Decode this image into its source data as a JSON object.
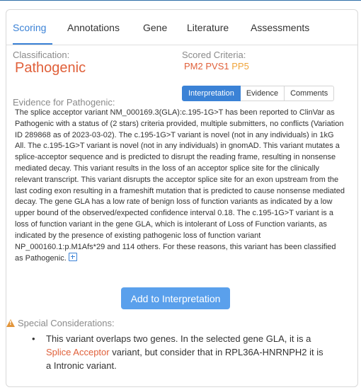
{
  "tabs": [
    {
      "label": "Scoring",
      "active": true
    },
    {
      "label": "Annotations",
      "active": false
    },
    {
      "label": "Gene",
      "active": false
    },
    {
      "label": "Literature",
      "active": false
    },
    {
      "label": "Assessments",
      "active": false
    }
  ],
  "classification": {
    "label": "Classification:",
    "value": "Pathogenic"
  },
  "scored_criteria": {
    "label": "Scored Criteria:",
    "items": [
      "PM2",
      "PVS1",
      "PP5"
    ]
  },
  "evidence": {
    "label": "Evidence for Pathogenic:",
    "views": [
      "Interpretation",
      "Evidence",
      "Comments"
    ],
    "active_view": "Interpretation",
    "text": "The splice acceptor variant NM_000169.3(GLA):c.195-1G>T has been reported to ClinVar as Pathogenic with a status of (2 stars) criteria provided, multiple submitters, no conflicts (Variation ID 289868 as of 2023-03-02). The c.195-1G>T variant is novel (not in any individuals) in 1kG All. The c.195-1G>T variant is novel (not in any individuals) in gnomAD. This variant mutates a splice-acceptor sequence and is predicted to disrupt the reading frame, resulting in nonsense mediated decay. This variant results in the loss of an acceptor splice site for the clinically relevant transcript. This variant disrupts the acceptor splice site for an exon upstream from the last coding exon resulting in a frameshift mutation that is predicted to cause nonsense mediated decay. The gene GLA has a low rate of benign loss of function variants as indicated by a low upper bound of the observed/expected confidence interval 0.18. The c.195-1G>T variant is a loss of function variant in the gene GLA, which is intolerant of Loss of Function variants, as indicated by the presence of existing pathogenic loss of function variant NP_000160.1:p.M1Afs*29 and 114 others. For these reasons, this variant has been classified as Pathogenic."
  },
  "add_button_label": "Add to Interpretation",
  "special": {
    "label": "Special Considerations:",
    "item": {
      "bullet": "•",
      "before": "This variant overlaps two genes. In the selected gene GLA, it is a ",
      "link": "Splice Acceptor",
      "after": " variant, but consider that in RPL36A-HNRNPH2 it is a Intronic variant."
    }
  },
  "colors": {
    "accent": "#3b82d6",
    "pathogenic": "#e0603a",
    "supporting": "#f0a43a",
    "warning": "#e2953a"
  },
  "icons": [
    "plus-square-icon",
    "warning-icon"
  ]
}
